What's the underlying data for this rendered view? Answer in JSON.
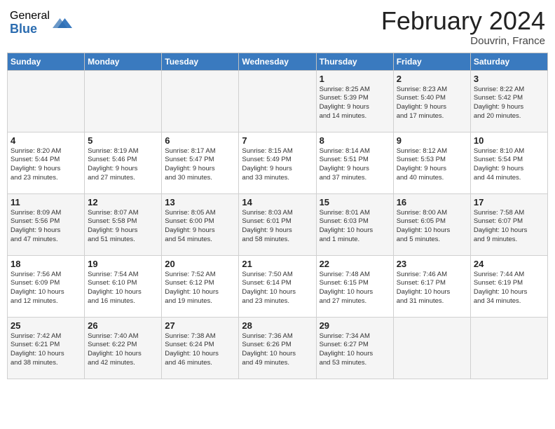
{
  "header": {
    "logo_general": "General",
    "logo_blue": "Blue",
    "month_year": "February 2024",
    "location": "Douvrin, France"
  },
  "days_of_week": [
    "Sunday",
    "Monday",
    "Tuesday",
    "Wednesday",
    "Thursday",
    "Friday",
    "Saturday"
  ],
  "weeks": [
    [
      {
        "day": "",
        "info": ""
      },
      {
        "day": "",
        "info": ""
      },
      {
        "day": "",
        "info": ""
      },
      {
        "day": "",
        "info": ""
      },
      {
        "day": "1",
        "info": "Sunrise: 8:25 AM\nSunset: 5:39 PM\nDaylight: 9 hours\nand 14 minutes."
      },
      {
        "day": "2",
        "info": "Sunrise: 8:23 AM\nSunset: 5:40 PM\nDaylight: 9 hours\nand 17 minutes."
      },
      {
        "day": "3",
        "info": "Sunrise: 8:22 AM\nSunset: 5:42 PM\nDaylight: 9 hours\nand 20 minutes."
      }
    ],
    [
      {
        "day": "4",
        "info": "Sunrise: 8:20 AM\nSunset: 5:44 PM\nDaylight: 9 hours\nand 23 minutes."
      },
      {
        "day": "5",
        "info": "Sunrise: 8:19 AM\nSunset: 5:46 PM\nDaylight: 9 hours\nand 27 minutes."
      },
      {
        "day": "6",
        "info": "Sunrise: 8:17 AM\nSunset: 5:47 PM\nDaylight: 9 hours\nand 30 minutes."
      },
      {
        "day": "7",
        "info": "Sunrise: 8:15 AM\nSunset: 5:49 PM\nDaylight: 9 hours\nand 33 minutes."
      },
      {
        "day": "8",
        "info": "Sunrise: 8:14 AM\nSunset: 5:51 PM\nDaylight: 9 hours\nand 37 minutes."
      },
      {
        "day": "9",
        "info": "Sunrise: 8:12 AM\nSunset: 5:53 PM\nDaylight: 9 hours\nand 40 minutes."
      },
      {
        "day": "10",
        "info": "Sunrise: 8:10 AM\nSunset: 5:54 PM\nDaylight: 9 hours\nand 44 minutes."
      }
    ],
    [
      {
        "day": "11",
        "info": "Sunrise: 8:09 AM\nSunset: 5:56 PM\nDaylight: 9 hours\nand 47 minutes."
      },
      {
        "day": "12",
        "info": "Sunrise: 8:07 AM\nSunset: 5:58 PM\nDaylight: 9 hours\nand 51 minutes."
      },
      {
        "day": "13",
        "info": "Sunrise: 8:05 AM\nSunset: 6:00 PM\nDaylight: 9 hours\nand 54 minutes."
      },
      {
        "day": "14",
        "info": "Sunrise: 8:03 AM\nSunset: 6:01 PM\nDaylight: 9 hours\nand 58 minutes."
      },
      {
        "day": "15",
        "info": "Sunrise: 8:01 AM\nSunset: 6:03 PM\nDaylight: 10 hours\nand 1 minute."
      },
      {
        "day": "16",
        "info": "Sunrise: 8:00 AM\nSunset: 6:05 PM\nDaylight: 10 hours\nand 5 minutes."
      },
      {
        "day": "17",
        "info": "Sunrise: 7:58 AM\nSunset: 6:07 PM\nDaylight: 10 hours\nand 9 minutes."
      }
    ],
    [
      {
        "day": "18",
        "info": "Sunrise: 7:56 AM\nSunset: 6:09 PM\nDaylight: 10 hours\nand 12 minutes."
      },
      {
        "day": "19",
        "info": "Sunrise: 7:54 AM\nSunset: 6:10 PM\nDaylight: 10 hours\nand 16 minutes."
      },
      {
        "day": "20",
        "info": "Sunrise: 7:52 AM\nSunset: 6:12 PM\nDaylight: 10 hours\nand 19 minutes."
      },
      {
        "day": "21",
        "info": "Sunrise: 7:50 AM\nSunset: 6:14 PM\nDaylight: 10 hours\nand 23 minutes."
      },
      {
        "day": "22",
        "info": "Sunrise: 7:48 AM\nSunset: 6:15 PM\nDaylight: 10 hours\nand 27 minutes."
      },
      {
        "day": "23",
        "info": "Sunrise: 7:46 AM\nSunset: 6:17 PM\nDaylight: 10 hours\nand 31 minutes."
      },
      {
        "day": "24",
        "info": "Sunrise: 7:44 AM\nSunset: 6:19 PM\nDaylight: 10 hours\nand 34 minutes."
      }
    ],
    [
      {
        "day": "25",
        "info": "Sunrise: 7:42 AM\nSunset: 6:21 PM\nDaylight: 10 hours\nand 38 minutes."
      },
      {
        "day": "26",
        "info": "Sunrise: 7:40 AM\nSunset: 6:22 PM\nDaylight: 10 hours\nand 42 minutes."
      },
      {
        "day": "27",
        "info": "Sunrise: 7:38 AM\nSunset: 6:24 PM\nDaylight: 10 hours\nand 46 minutes."
      },
      {
        "day": "28",
        "info": "Sunrise: 7:36 AM\nSunset: 6:26 PM\nDaylight: 10 hours\nand 49 minutes."
      },
      {
        "day": "29",
        "info": "Sunrise: 7:34 AM\nSunset: 6:27 PM\nDaylight: 10 hours\nand 53 minutes."
      },
      {
        "day": "",
        "info": ""
      },
      {
        "day": "",
        "info": ""
      }
    ]
  ]
}
